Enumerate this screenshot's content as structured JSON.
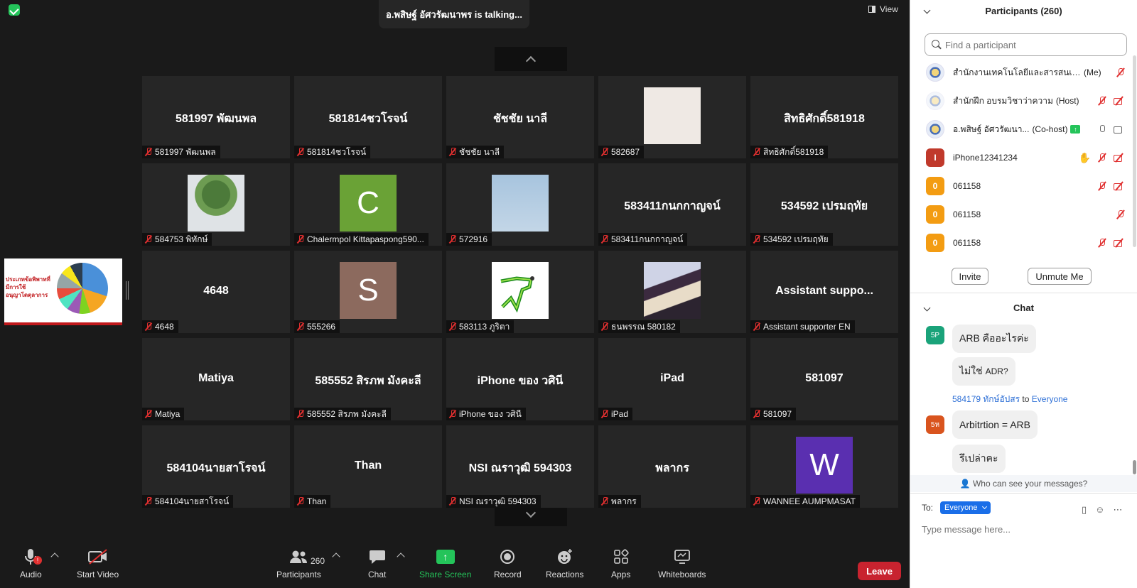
{
  "topbar": {
    "talking": "อ.พสิษฐ์ อัศวรัฒนาพร is talking...",
    "view_label": "View"
  },
  "tiles": [
    {
      "big": "581997 พัฒนพล",
      "label": "581997 พัฒนพล"
    },
    {
      "big": "581814ชวโรจน์",
      "label": "581814ชวโรจน์"
    },
    {
      "big": "ชัชชัย นาลี",
      "label": "ชัชชัย นาลี"
    },
    {
      "big": "",
      "label": "582687"
    },
    {
      "big": "สิทธิศักดิ์581918",
      "label": "สิทธิศักดิ์581918"
    },
    {
      "big": "",
      "label": "584753 พิทักษ์"
    },
    {
      "big": "C",
      "label": "Chalermpol Kittapaspong590..."
    },
    {
      "big": "",
      "label": "572916"
    },
    {
      "big": "583411กนกกาญจน์",
      "label": "583411กนกกาญจน์"
    },
    {
      "big": "534592 เปรมฤทัย",
      "label": "534592 เปรมฤทัย"
    },
    {
      "big": "4648",
      "label": "4648"
    },
    {
      "big": "S",
      "label": "555266"
    },
    {
      "big": "",
      "label": "583113 ภูริตา"
    },
    {
      "big": "",
      "label": "ธนพรรณ 580182"
    },
    {
      "big": "Assistant suppo...",
      "label": "Assistant supporter EN"
    },
    {
      "big": "Matiya",
      "label": "Matiya"
    },
    {
      "big": "585552 สิรภพ มังคะลี",
      "label": "585552 สิรภพ มังคะลี"
    },
    {
      "big": "iPhone ของ วศินี",
      "label": "iPhone ของ วศินี"
    },
    {
      "big": "iPad",
      "label": "iPad"
    },
    {
      "big": "581097",
      "label": "581097"
    },
    {
      "big": "584104นายสาโรจน์",
      "label": "584104นายสาโรจน์"
    },
    {
      "big": "Than",
      "label": "Than"
    },
    {
      "big": "NSI ณราวุฒิ 594303",
      "label": "NSI ณราวุฒิ 594303"
    },
    {
      "big": "พลากร",
      "label": "พลากร"
    },
    {
      "big": "W",
      "label": "WANNEE AUMPMASAT"
    }
  ],
  "shared_thumb_text": "ประเภทข้อพิพาทที่มีการใช้อนุญาโตตุลาการ",
  "toolbar": {
    "audio": "Audio",
    "audio_badge": "!",
    "start_video": "Start Video",
    "participants": "Participants",
    "participants_count": "260",
    "chat": "Chat",
    "share_screen": "Share Screen",
    "record": "Record",
    "reactions": "Reactions",
    "apps": "Apps",
    "whiteboards": "Whiteboards",
    "leave": "Leave"
  },
  "participants_panel": {
    "title": "Participants (260)",
    "search_placeholder": "Find a participant",
    "rows": [
      {
        "avatar": "",
        "name": "สำนักงานเทคโนโลยีและสารสนเทศ ส...",
        "tag": "(Me)"
      },
      {
        "avatar": "",
        "name": "สำนักฝึก อบรมวิชาว่าความ",
        "tag": "(Host)"
      },
      {
        "avatar": "",
        "name": "อ.พสิษฐ์ อัศวรัฒนา...",
        "tag": "(Co-host)"
      },
      {
        "avatar": "I",
        "name": "iPhone12341234",
        "tag": ""
      },
      {
        "avatar": "0",
        "name": "061158",
        "tag": ""
      },
      {
        "avatar": "0",
        "name": "061158",
        "tag": ""
      },
      {
        "avatar": "0",
        "name": "061158",
        "tag": ""
      }
    ],
    "invite": "Invite",
    "unmute_me": "Unmute Me"
  },
  "chat_panel": {
    "title": "Chat",
    "messages": [
      {
        "avatar": "5P",
        "text": "ARB คืออะไรค่ะ"
      },
      {
        "text": "ไม่ใช่",
        "small": "ADR?"
      },
      {
        "avatar": "5ห",
        "text": "Arbitrtion = ARB"
      },
      {
        "text": "รึเปล่าคะ"
      }
    ],
    "sender_name": "584179 ทักษ์อัปสร",
    "sender_to": "to",
    "sender_target": "Everyone",
    "who_can_see": "Who can see your messages?",
    "to_label": "To:",
    "to_value": "Everyone",
    "input_placeholder": "Type message here..."
  },
  "colors": {
    "accent_blue": "#1a6ee8",
    "leave_red": "#c8232f",
    "share_green": "#24c45a",
    "tile_bg": "#262626"
  }
}
